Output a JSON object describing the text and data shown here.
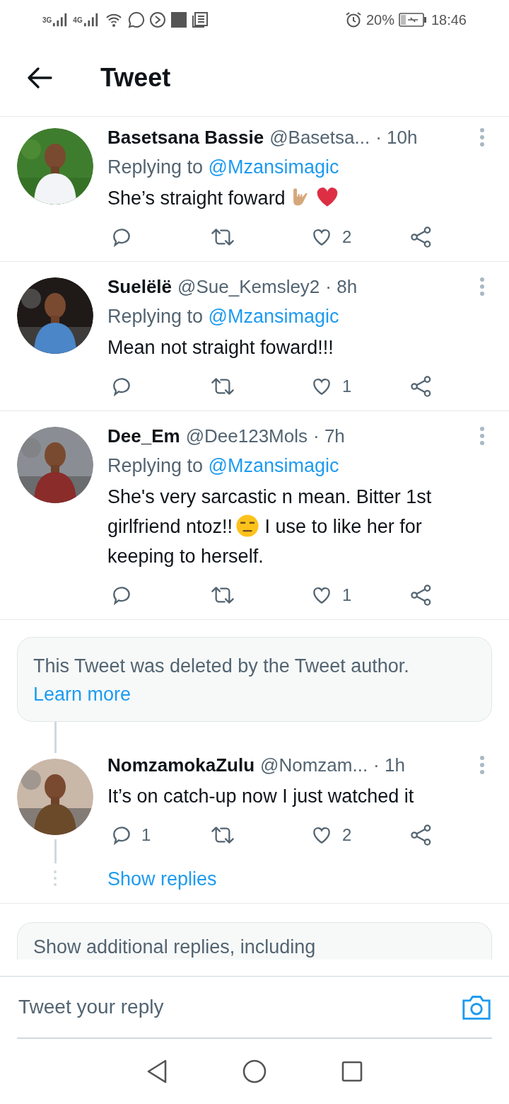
{
  "status_bar": {
    "networks": [
      "3G",
      "4G"
    ],
    "battery": "20%",
    "time": "18:46"
  },
  "header": {
    "title": "Tweet"
  },
  "tweets": [
    {
      "name": "Basetsana Bassie",
      "handle": "@Basetsa...",
      "time": "· 10h",
      "replying_label": "Replying to",
      "replying_to": "@Mzansimagic",
      "body": [
        {
          "kind": "text",
          "text": "She’s straight foward"
        },
        {
          "kind": "hand"
        },
        {
          "kind": "heart"
        }
      ],
      "likes": "2",
      "avatar": {
        "kind": "picture"
      }
    },
    {
      "name": "Suelëlë",
      "handle": "@Sue_Kemsley2",
      "time": "· 8h",
      "replying_label": "Replying to",
      "replying_to": "@Mzansimagic",
      "body": [
        {
          "kind": "text",
          "text": "Mean not straight foward!!!"
        }
      ],
      "likes": "1",
      "avatar": {
        "kind": "picture"
      }
    },
    {
      "name": "Dee_Em",
      "handle": "@Dee123Mols",
      "time": "· 7h",
      "replying_label": "Replying to",
      "replying_to": "@Mzansimagic",
      "body": [
        {
          "kind": "text",
          "text": "She's very sarcastic n mean. Bitter 1st girlfriend ntoz!!"
        },
        {
          "kind": "unamused"
        },
        {
          "kind": "text",
          "text": " I use to like her for keeping to herself."
        }
      ],
      "likes": "1",
      "avatar": {
        "kind": "picture"
      }
    }
  ],
  "deleted_notice": {
    "text": "This Tweet was deleted by the Tweet author.",
    "link": "Learn more"
  },
  "thread_reply": {
    "name": "NomzamokaZulu",
    "handle": "@Nomzam...",
    "time": "· 1h",
    "body": [
      {
        "kind": "text",
        "text": "It’s on catch-up now I just watched it"
      }
    ],
    "replies": "1",
    "likes": "2",
    "show_replies": "Show replies",
    "avatar": {
      "kind": "picture"
    }
  },
  "more_replies": {
    "text": "Show additional replies, including"
  },
  "compose": {
    "placeholder": "Tweet your reply"
  }
}
